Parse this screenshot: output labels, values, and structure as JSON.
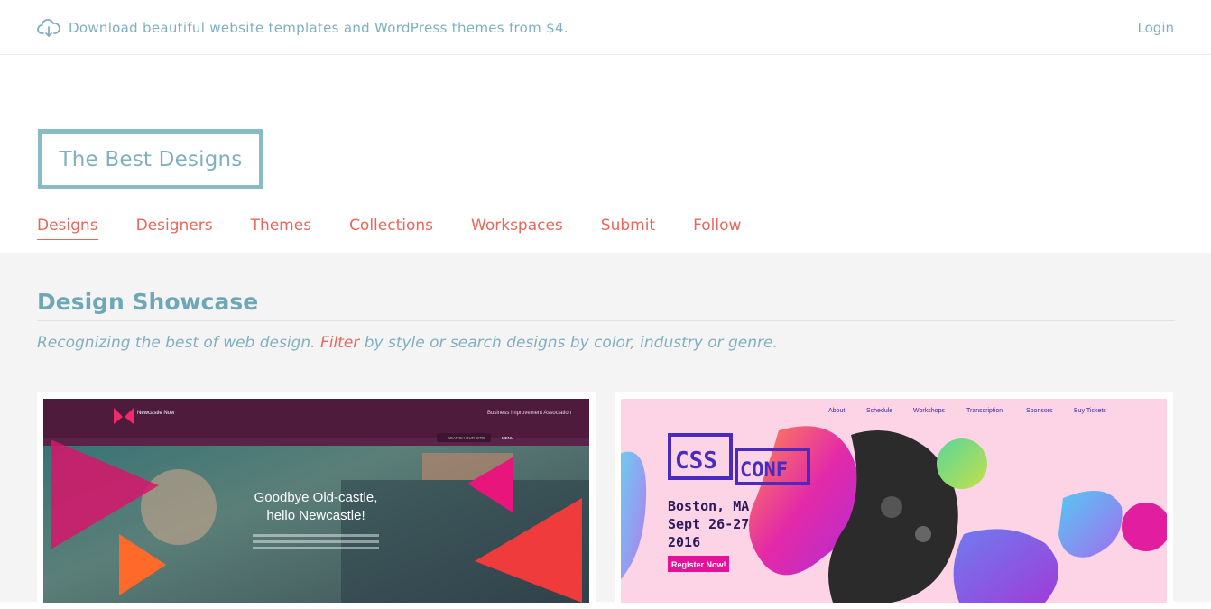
{
  "topbar": {
    "promo_text": "Download beautiful website templates and WordPress themes from $4.",
    "login_label": "Login",
    "icon": "cloud-download-icon"
  },
  "logo": {
    "text": "The Best Designs"
  },
  "nav": {
    "items": [
      {
        "label": "Designs",
        "active": true
      },
      {
        "label": "Designers"
      },
      {
        "label": "Themes"
      },
      {
        "label": "Collections"
      },
      {
        "label": "Workspaces"
      },
      {
        "label": "Submit"
      },
      {
        "label": "Follow"
      }
    ]
  },
  "showcase": {
    "heading": "Design Showcase",
    "subtitle_before": "Recognizing the best of web design. ",
    "subtitle_link": "Filter",
    "subtitle_after": " by style or search designs by color, industry or genre."
  },
  "cards": [
    {
      "brand": "Newcastle Now",
      "partner": "Business Improvement Association",
      "search_placeholder": "SEARCH OUR SITE",
      "menu_label": "MENU",
      "headline_line1": "Goodbye Old-castle,",
      "headline_line2": "hello Newcastle!"
    },
    {
      "nav_links": [
        "About",
        "Schedule",
        "Workshops",
        "Transcription",
        "Sponsors",
        "Buy Tickets"
      ],
      "logo_left": "CSS",
      "logo_right": "CONF",
      "city": "Boston, MA",
      "dates": "Sept 26-27",
      "year": "2016",
      "cta": "Register Now!"
    }
  ],
  "colors": {
    "accent_teal": "#7fb0c0",
    "accent_coral": "#e8675a",
    "logo_border": "#87bcc6",
    "content_bg": "#f4f4f4"
  }
}
